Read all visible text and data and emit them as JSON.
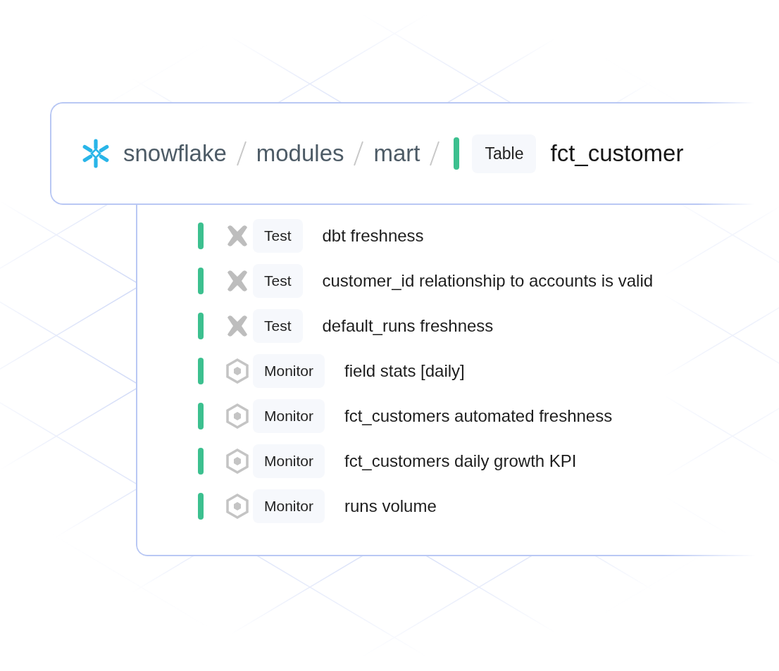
{
  "breadcrumb": {
    "items": [
      "snowflake",
      "modules",
      "mart"
    ],
    "color": "#3cc08f",
    "type_badge": "Table",
    "name": "fct_customer"
  },
  "checks": [
    {
      "kind": "test",
      "badge": "Test",
      "name": "dbt freshness",
      "color": "#3cc08f"
    },
    {
      "kind": "test",
      "badge": "Test",
      "name": "customer_id relationship to accounts is valid",
      "color": "#3cc08f"
    },
    {
      "kind": "test",
      "badge": "Test",
      "name": "default_runs freshness",
      "color": "#3cc08f"
    },
    {
      "kind": "monitor",
      "badge": "Monitor",
      "name": "field stats [daily]",
      "color": "#3cc08f"
    },
    {
      "kind": "monitor",
      "badge": "Monitor",
      "name": "fct_customers automated freshness",
      "color": "#3cc08f"
    },
    {
      "kind": "monitor",
      "badge": "Monitor",
      "name": "fct_customers daily growth KPI",
      "color": "#3cc08f"
    },
    {
      "kind": "monitor",
      "badge": "Monitor",
      "name": "runs volume",
      "color": "#3cc08f"
    }
  ]
}
